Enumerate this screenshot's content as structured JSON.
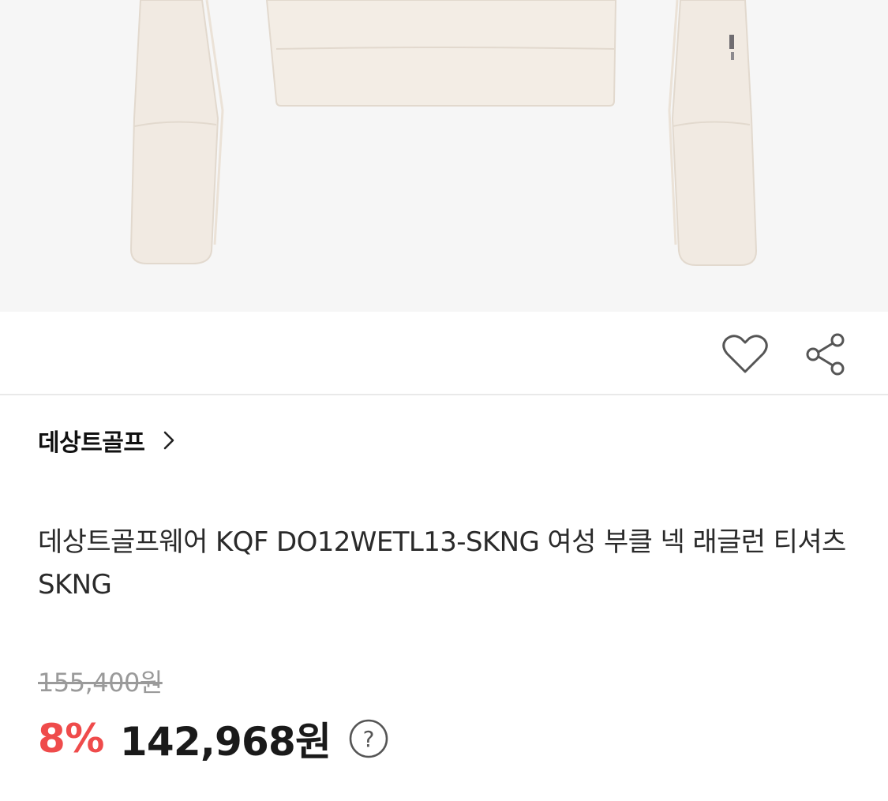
{
  "product": {
    "brand": "데상트골프",
    "title": "데상트골프웨어 KQF DO12WETL13-SKNG 여성 부클 넥 래글런 티셔츠 SKNG",
    "original_price": "155,400원",
    "discount": "8%",
    "sale_price": "142,968원"
  },
  "icons": {
    "wishlist": "heart-icon",
    "share": "share-icon",
    "brand_link": "chevron-right-icon",
    "price_help": "question-circle-icon"
  },
  "colors": {
    "discount": "#ef4b4b",
    "garment": "#f3ede5",
    "image_background": "#f6f6f6"
  }
}
